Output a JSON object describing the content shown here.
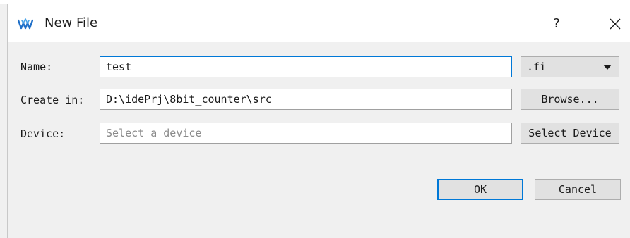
{
  "window": {
    "title": "New File",
    "help_glyph": "?",
    "close_icon": "close-icon",
    "logo_icon": "gowin-logo-icon",
    "accent_color": "#0078d7",
    "logo_color": "#1e6fc8"
  },
  "form": {
    "name_label": "Name:",
    "name_value": "test",
    "extension_value": ".fi",
    "create_in_label": "Create in:",
    "create_in_value": "D:\\idePrj\\8bit_counter\\src",
    "browse_label": "Browse...",
    "device_label": "Device:",
    "device_placeholder": "Select a device",
    "select_device_label": "Select Device"
  },
  "buttons": {
    "ok_label": "OK",
    "cancel_label": "Cancel"
  }
}
